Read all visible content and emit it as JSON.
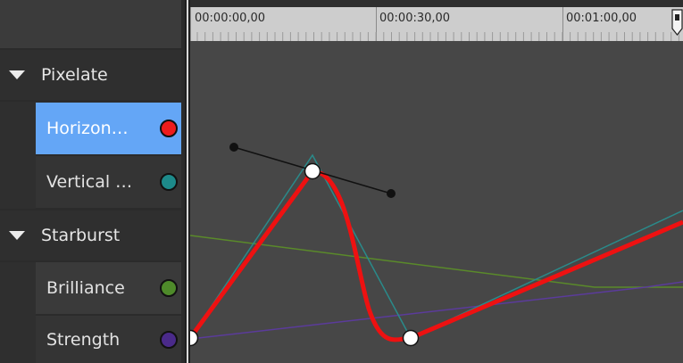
{
  "ruler": {
    "labels": [
      "00:00:00,00",
      "00:00:30,00",
      "00:01:00,00"
    ]
  },
  "groups": [
    {
      "name": "Pixelate",
      "tracks": [
        {
          "label": "Horizon…",
          "color": "#ee1c1c",
          "selected": true
        },
        {
          "label": "Vertical …",
          "color": "#1d8a8a",
          "selected": false
        }
      ]
    },
    {
      "name": "Starburst",
      "tracks": [
        {
          "label": "Brilliance",
          "color": "#4e8a2a",
          "selected": false
        },
        {
          "label": "Strength",
          "color": "#4a2a8a",
          "selected": false
        }
      ]
    }
  ],
  "colors": {
    "selected_track": "#64a6f6",
    "curve_horizontal": "#ee1111",
    "curve_vertical": "#2a8a8a",
    "curve_brilliance": "#5a8a2a",
    "curve_strength": "#5a3a9a",
    "keyframe": "#ffffff",
    "handle": "#111111"
  }
}
